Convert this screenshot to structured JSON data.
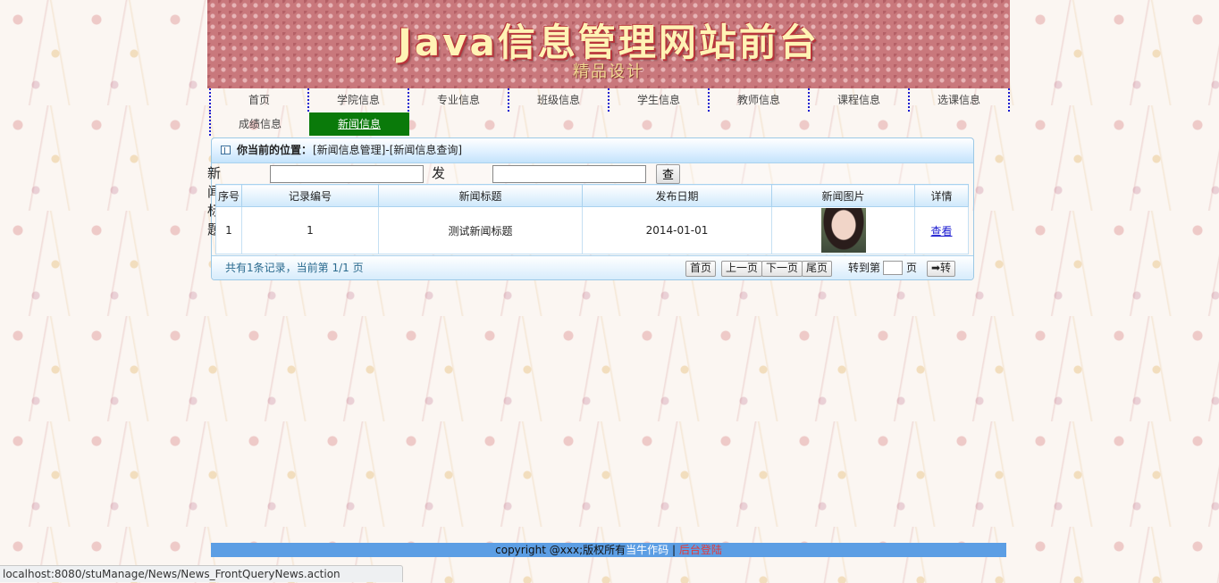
{
  "banner": {
    "title": "Java信息管理网站前台",
    "subtitle": "精品设计"
  },
  "nav": {
    "items": [
      {
        "label": "首页"
      },
      {
        "label": "学院信息"
      },
      {
        "label": "专业信息"
      },
      {
        "label": "班级信息"
      },
      {
        "label": "学生信息"
      },
      {
        "label": "教师信息"
      },
      {
        "label": "课程信息"
      },
      {
        "label": "选课信息"
      },
      {
        "label": "成绩信息"
      },
      {
        "label": "新闻信息"
      }
    ],
    "active": "新闻信息"
  },
  "breadcrumb": {
    "label": "你当前的位置：",
    "path": "[新闻信息管理]-[新闻信息查询]"
  },
  "search": {
    "title_label": "新闻标题:",
    "title_value": "",
    "date_label": "发布日期:",
    "date_value": "",
    "button": "查询"
  },
  "table": {
    "columns": [
      "序号",
      "记录编号",
      "新闻标题",
      "发布日期",
      "新闻图片",
      "详情"
    ],
    "rows": [
      {
        "index": "1",
        "record_id": "1",
        "title": "测试新闻标题",
        "date": "2014-01-01",
        "image_icon": "news-photo",
        "detail": "查看"
      }
    ]
  },
  "pager": {
    "info": "共有1条记录，当前第 1/1 页",
    "first": "首页",
    "prev": "上一页",
    "next": "下一页",
    "last": "尾页",
    "goto_prefix": "转到第",
    "page_value": "",
    "goto_suffix": "页",
    "go": "➡转"
  },
  "footer": {
    "copyright": "copyright @xxx;版权所有",
    "author_link": "当牛作码",
    "separator": " | ",
    "admin_link": "后台登陆"
  },
  "statusbar": {
    "url": "localhost:8080/stuManage/News/News_FrontQueryNews.action"
  },
  "colors": {
    "nav_active": "#0a7a0a",
    "footer_bg": "#5c9ee4",
    "admin_link": "#e23a3a",
    "banner_title": "#fff3b5"
  }
}
